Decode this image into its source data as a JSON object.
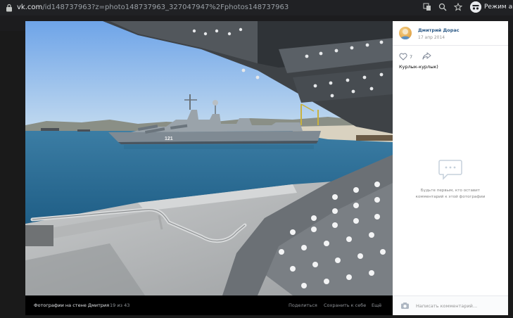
{
  "browser": {
    "url_host": "vk.com",
    "url_path": "/id148737963?z=photo148737963_327047947%2Fphotos148737963",
    "profile_label": "Режим ано"
  },
  "photo": {
    "hull_number": "121"
  },
  "photo_bar": {
    "album": "Фотографии на стене Дмитрия",
    "counter": "19 из 43",
    "share": "Поделиться",
    "save": "Сохранить к себе",
    "more": "Ещё"
  },
  "side": {
    "author": "Дмитрий Дорас",
    "date": "17 апр 2014",
    "likes": "7",
    "caption": "Курлык-курлык)",
    "empty_line1": "Будьте первым, кто оставит",
    "empty_line2": "комментарий к этой фотографии",
    "comment_placeholder": "Написать комментарий..."
  },
  "colors": {
    "link": "#2a5885",
    "browser_bar": "#202124"
  },
  "icons": [
    "lock-icon",
    "translate-icon",
    "zoom-icon",
    "star-icon",
    "incognito-icon",
    "heart-icon",
    "share-icon",
    "comments-icon",
    "camera-icon"
  ]
}
